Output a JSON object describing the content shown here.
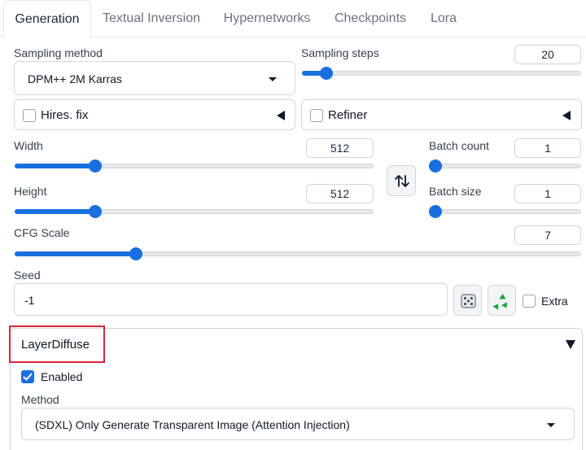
{
  "tabs": [
    "Generation",
    "Textual Inversion",
    "Hypernetworks",
    "Checkpoints",
    "Lora"
  ],
  "sampling": {
    "method_label": "Sampling method",
    "method_value": "DPM++ 2M Karras",
    "steps_label": "Sampling steps",
    "steps_value": "20",
    "steps_level": 0.0667
  },
  "hires": {
    "label": "Hires. fix",
    "checked": false
  },
  "refiner": {
    "label": "Refiner",
    "checked": false
  },
  "width": {
    "label": "Width",
    "value": "512",
    "level": 0.2143
  },
  "height": {
    "label": "Height",
    "value": "512",
    "level": 0.2143
  },
  "batch_count": {
    "label": "Batch count",
    "value": "1",
    "level": 0.0
  },
  "batch_size": {
    "label": "Batch size",
    "value": "1",
    "level": 0.0
  },
  "cfg": {
    "label": "CFG Scale",
    "value": "7",
    "level": 0.2069
  },
  "seed": {
    "label": "Seed",
    "value": "-1",
    "extra_label": "Extra"
  },
  "icons": {
    "swap": "swap-arrows-icon",
    "dice": "dice-icon",
    "recycle": "recycle-icon",
    "hires_collapse": "triangle-left-icon",
    "refiner_collapse": "triangle-left-icon",
    "layerdiffuse_collapse": "triangle-down-icon"
  },
  "layerdiffuse": {
    "title": "LayerDiffuse",
    "enabled_label": "Enabled",
    "enabled": true,
    "method_label": "Method",
    "method_value": "(SDXL) Only Generate Transparent Image (Attention Injection)"
  },
  "colors": {
    "accent": "#1a6fe0",
    "highlight_box": "#d7263d"
  }
}
